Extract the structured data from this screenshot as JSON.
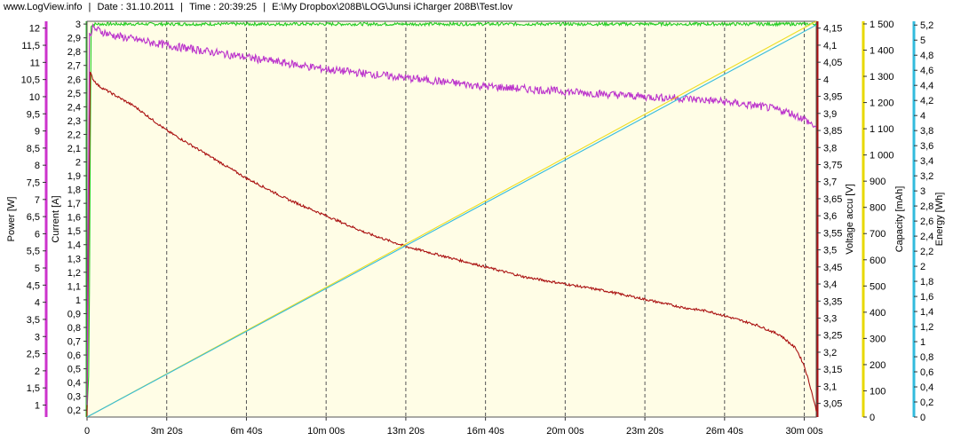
{
  "header": {
    "site": "www.LogView.info",
    "sep1": "|",
    "date": "Date : 31.10.2011",
    "sep2": "|",
    "time": "Time : 20:39:25",
    "sep3": "|",
    "path": "E:\\My Dropbox\\208B\\LOG\\Junsi iCharger 208B\\Test.lov"
  },
  "chart_data": {
    "type": "line",
    "title": "",
    "xlabel": "",
    "x_ticks": [
      "0",
      "3m 20s",
      "6m 40s",
      "10m 00s",
      "13m 20s",
      "16m 40s",
      "20m 00s",
      "23m 20s",
      "26m 40s",
      "30m 00s"
    ],
    "xlim": [
      0,
      1830
    ],
    "x_unit": "s",
    "grid_vertical": true,
    "plot_background": "#fffde6",
    "axes": {
      "power": {
        "label": "Power [W]",
        "color": "#cc33cc",
        "range": [
          0.65,
          12.2
        ],
        "ticks": [
          "1",
          "1,5",
          "2",
          "2,5",
          "3",
          "3,5",
          "4",
          "4,5",
          "5",
          "5,5",
          "6",
          "6,5",
          "7",
          "7,5",
          "8",
          "8,5",
          "9",
          "9,5",
          "10",
          "10,5",
          "11",
          "11,5",
          "12"
        ]
      },
      "current": {
        "label": "Current [A]",
        "color": "#22bb22",
        "range": [
          0.15,
          3.02
        ],
        "ticks": [
          "0,2",
          "0,3",
          "0,4",
          "0,5",
          "0,6",
          "0,7",
          "0,8",
          "0,9",
          "1",
          "1,1",
          "1,2",
          "1,3",
          "1,4",
          "1,5",
          "1,6",
          "1,7",
          "1,8",
          "1,9",
          "2",
          "2,1",
          "2,2",
          "2,3",
          "2,4",
          "2,5",
          "2,6",
          "2,7",
          "2,8",
          "2,9",
          "3"
        ]
      },
      "voltage": {
        "label": "Voltage accu [V]",
        "color": "#aa1111",
        "range": [
          3.01,
          4.17
        ],
        "ticks": [
          "3,05",
          "3,1",
          "3,15",
          "3,2",
          "3,25",
          "3,3",
          "3,35",
          "3,4",
          "3,45",
          "3,5",
          "3,55",
          "3,6",
          "3,65",
          "3,7",
          "3,75",
          "3,8",
          "3,85",
          "3,9",
          "3,95",
          "4",
          "4,05",
          "4,1",
          "4,15"
        ]
      },
      "capacity": {
        "label": "Capacity [mAh]",
        "color": "#e8d800",
        "range": [
          0,
          1510
        ],
        "ticks": [
          "0",
          "100",
          "200",
          "300",
          "400",
          "500",
          "600",
          "700",
          "800",
          "900",
          "1 000",
          "1 100",
          "1 200",
          "1 300",
          "1 400",
          "1 500"
        ]
      },
      "energy": {
        "label": "Energy [Wh]",
        "color": "#33bbdd",
        "range": [
          0,
          5.25
        ],
        "ticks": [
          "0",
          "0,2",
          "0,4",
          "0,6",
          "0,8",
          "1",
          "1,2",
          "1,4",
          "1,6",
          "1,8",
          "2",
          "2,2",
          "2,4",
          "2,6",
          "2,8",
          "3",
          "3,2",
          "3,4",
          "3,6",
          "3,8",
          "4",
          "4,2",
          "4,4",
          "4,6",
          "4,8",
          "5",
          "5,2"
        ]
      }
    },
    "series": [
      {
        "axis": "current",
        "color": "#22cc22",
        "noise": 0.008,
        "x": [
          0,
          5,
          10,
          20,
          1830
        ],
        "y": [
          0.2,
          0.5,
          2.99,
          3.0,
          3.0
        ]
      },
      {
        "axis": "voltage",
        "color": "#aa1111",
        "noise": 0.006,
        "x": [
          0,
          8,
          15,
          30,
          60,
          120,
          200,
          300,
          400,
          500,
          600,
          700,
          800,
          900,
          1000,
          1100,
          1200,
          1300,
          1400,
          1500,
          1560,
          1620,
          1680,
          1740,
          1780,
          1800,
          1815,
          1830
        ],
        "y": [
          3.01,
          4.02,
          4.0,
          3.98,
          3.96,
          3.92,
          3.85,
          3.78,
          3.71,
          3.65,
          3.6,
          3.55,
          3.51,
          3.48,
          3.45,
          3.42,
          3.4,
          3.38,
          3.355,
          3.33,
          3.32,
          3.3,
          3.28,
          3.25,
          3.21,
          3.16,
          3.1,
          3.03
        ]
      },
      {
        "axis": "power",
        "color": "#bb33cc",
        "noise": 0.02,
        "x": [
          0,
          6,
          15,
          60,
          200,
          400,
          600,
          800,
          1000,
          1200,
          1400,
          1500,
          1600,
          1700,
          1760,
          1800,
          1830
        ],
        "y": [
          1.0,
          11.8,
          12.0,
          11.8,
          11.5,
          11.15,
          10.8,
          10.55,
          10.3,
          10.15,
          10.0,
          9.95,
          9.85,
          9.7,
          9.55,
          9.35,
          9.1
        ]
      },
      {
        "axis": "capacity",
        "color": "#eedd22",
        "noise": 0,
        "x": [
          0,
          1830
        ],
        "y": [
          0,
          1510
        ]
      },
      {
        "axis": "energy",
        "color": "#33bbdd",
        "noise": 0,
        "x": [
          0,
          1830
        ],
        "y": [
          0,
          5.2
        ]
      }
    ]
  }
}
